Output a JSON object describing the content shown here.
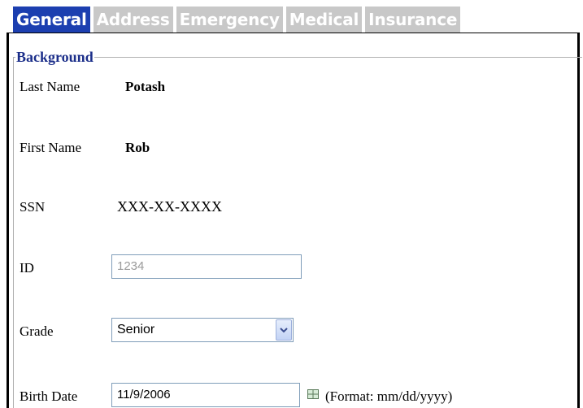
{
  "tabs": [
    {
      "label": "General",
      "active": true
    },
    {
      "label": "Address",
      "active": false
    },
    {
      "label": "Emergency",
      "active": false
    },
    {
      "label": "Medical",
      "active": false
    },
    {
      "label": "Insurance",
      "active": false
    }
  ],
  "background_section": {
    "legend": "Background",
    "last_name": {
      "label": "Last Name",
      "value": "Potash"
    },
    "first_name": {
      "label": "First Name",
      "value": "Rob"
    },
    "ssn": {
      "label": "SSN",
      "value": "XXX-XX-XXXX"
    },
    "id": {
      "label": "ID",
      "value": "1234"
    },
    "grade": {
      "label": "Grade",
      "selected": "Senior"
    },
    "birth_date": {
      "label": "Birth Date",
      "value": "11/9/2006",
      "format_hint": "(Format: mm/dd/yyyy)"
    }
  },
  "colors": {
    "active_tab": "#1c3fb0",
    "inactive_tab": "#c8c8c8",
    "legend": "#1c2f8a"
  },
  "icons": {
    "grade_dropdown": "chevron-down-icon",
    "birth_date_picker": "calendar-icon"
  }
}
